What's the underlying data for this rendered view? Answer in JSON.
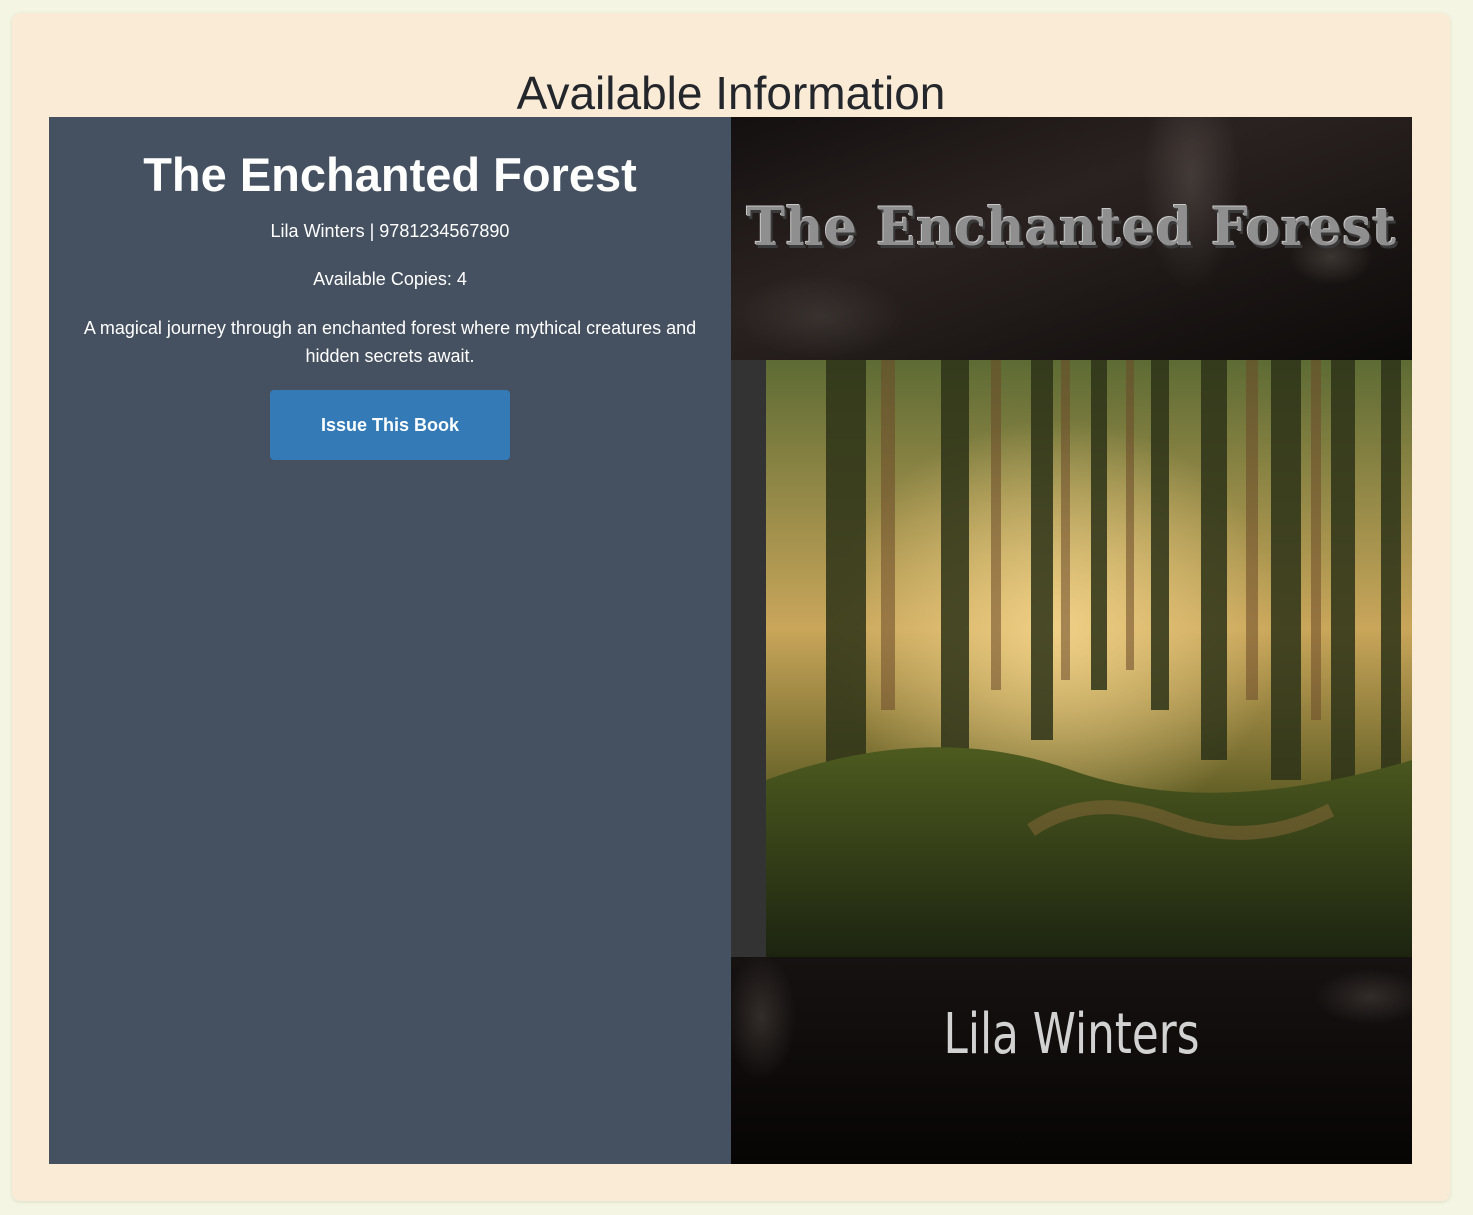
{
  "page": {
    "title": "Available Information"
  },
  "book": {
    "title": "The Enchanted Forest",
    "author": "Lila Winters",
    "separator": "|",
    "isbn": "9781234567890",
    "copies_label": "Available Copies:",
    "copies": "4",
    "description": "A magical journey through an enchanted forest where mythical creatures and hidden secrets await.",
    "issue_label": "Issue This Book"
  },
  "cover": {
    "title": "The Enchanted Forest",
    "author": "Lila Winters"
  },
  "colors": {
    "page_background": "#f4f6e3",
    "card_background": "#faebd7",
    "info_panel": "#455161",
    "button": "#337ab7"
  }
}
